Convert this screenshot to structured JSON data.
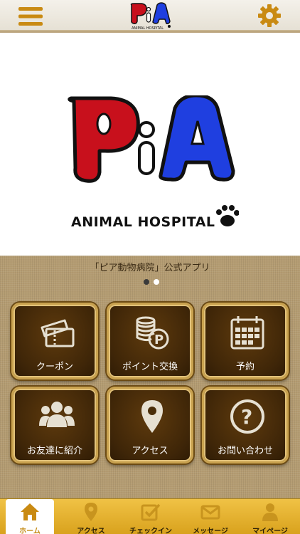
{
  "header": {
    "logo_text": "PiA",
    "logo_sub": "ANIMAL HOSPITAL"
  },
  "hero": {
    "logo_text": "PiA",
    "logo_sub": "ANIMAL HOSPITAL"
  },
  "tagline": "「ピア動物病院」公式アプリ",
  "carousel": {
    "count": 2,
    "active_index": 0
  },
  "tiles": [
    {
      "label": "クーポン",
      "icon": "ticket-icon"
    },
    {
      "label": "ポイント交換",
      "icon": "coins-icon"
    },
    {
      "label": "予約",
      "icon": "calendar-icon"
    },
    {
      "label": "お友達に紹介",
      "icon": "people-icon"
    },
    {
      "label": "アクセス",
      "icon": "map-pin-icon"
    },
    {
      "label": "お問い合わせ",
      "icon": "question-icon"
    }
  ],
  "bottom_nav": [
    {
      "label": "ホーム",
      "icon": "home-icon",
      "active": true
    },
    {
      "label": "アクセス",
      "icon": "map-pin-icon",
      "active": false
    },
    {
      "label": "チェックイン",
      "icon": "checkin-icon",
      "active": false
    },
    {
      "label": "メッセージ",
      "icon": "envelope-icon",
      "active": false
    },
    {
      "label": "マイページ",
      "icon": "person-icon",
      "active": false
    }
  ],
  "colors": {
    "accent_gold": "#d9a21d",
    "tile_brown": "#3f2608",
    "logo_red": "#c8101c",
    "logo_blue": "#1f3fe0"
  }
}
